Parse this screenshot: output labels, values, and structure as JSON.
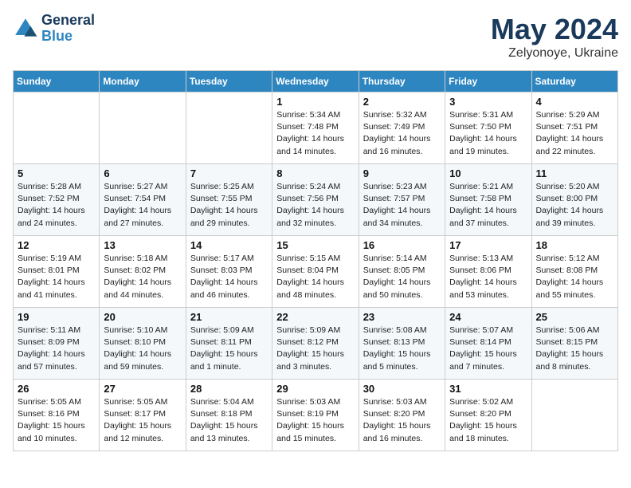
{
  "header": {
    "logo_line1": "General",
    "logo_line2": "Blue",
    "month": "May 2024",
    "location": "Zelyonoye, Ukraine"
  },
  "weekdays": [
    "Sunday",
    "Monday",
    "Tuesday",
    "Wednesday",
    "Thursday",
    "Friday",
    "Saturday"
  ],
  "weeks": [
    [
      {
        "day": "",
        "info": ""
      },
      {
        "day": "",
        "info": ""
      },
      {
        "day": "",
        "info": ""
      },
      {
        "day": "1",
        "info": "Sunrise: 5:34 AM\nSunset: 7:48 PM\nDaylight: 14 hours\nand 14 minutes."
      },
      {
        "day": "2",
        "info": "Sunrise: 5:32 AM\nSunset: 7:49 PM\nDaylight: 14 hours\nand 16 minutes."
      },
      {
        "day": "3",
        "info": "Sunrise: 5:31 AM\nSunset: 7:50 PM\nDaylight: 14 hours\nand 19 minutes."
      },
      {
        "day": "4",
        "info": "Sunrise: 5:29 AM\nSunset: 7:51 PM\nDaylight: 14 hours\nand 22 minutes."
      }
    ],
    [
      {
        "day": "5",
        "info": "Sunrise: 5:28 AM\nSunset: 7:52 PM\nDaylight: 14 hours\nand 24 minutes."
      },
      {
        "day": "6",
        "info": "Sunrise: 5:27 AM\nSunset: 7:54 PM\nDaylight: 14 hours\nand 27 minutes."
      },
      {
        "day": "7",
        "info": "Sunrise: 5:25 AM\nSunset: 7:55 PM\nDaylight: 14 hours\nand 29 minutes."
      },
      {
        "day": "8",
        "info": "Sunrise: 5:24 AM\nSunset: 7:56 PM\nDaylight: 14 hours\nand 32 minutes."
      },
      {
        "day": "9",
        "info": "Sunrise: 5:23 AM\nSunset: 7:57 PM\nDaylight: 14 hours\nand 34 minutes."
      },
      {
        "day": "10",
        "info": "Sunrise: 5:21 AM\nSunset: 7:58 PM\nDaylight: 14 hours\nand 37 minutes."
      },
      {
        "day": "11",
        "info": "Sunrise: 5:20 AM\nSunset: 8:00 PM\nDaylight: 14 hours\nand 39 minutes."
      }
    ],
    [
      {
        "day": "12",
        "info": "Sunrise: 5:19 AM\nSunset: 8:01 PM\nDaylight: 14 hours\nand 41 minutes."
      },
      {
        "day": "13",
        "info": "Sunrise: 5:18 AM\nSunset: 8:02 PM\nDaylight: 14 hours\nand 44 minutes."
      },
      {
        "day": "14",
        "info": "Sunrise: 5:17 AM\nSunset: 8:03 PM\nDaylight: 14 hours\nand 46 minutes."
      },
      {
        "day": "15",
        "info": "Sunrise: 5:15 AM\nSunset: 8:04 PM\nDaylight: 14 hours\nand 48 minutes."
      },
      {
        "day": "16",
        "info": "Sunrise: 5:14 AM\nSunset: 8:05 PM\nDaylight: 14 hours\nand 50 minutes."
      },
      {
        "day": "17",
        "info": "Sunrise: 5:13 AM\nSunset: 8:06 PM\nDaylight: 14 hours\nand 53 minutes."
      },
      {
        "day": "18",
        "info": "Sunrise: 5:12 AM\nSunset: 8:08 PM\nDaylight: 14 hours\nand 55 minutes."
      }
    ],
    [
      {
        "day": "19",
        "info": "Sunrise: 5:11 AM\nSunset: 8:09 PM\nDaylight: 14 hours\nand 57 minutes."
      },
      {
        "day": "20",
        "info": "Sunrise: 5:10 AM\nSunset: 8:10 PM\nDaylight: 14 hours\nand 59 minutes."
      },
      {
        "day": "21",
        "info": "Sunrise: 5:09 AM\nSunset: 8:11 PM\nDaylight: 15 hours\nand 1 minute."
      },
      {
        "day": "22",
        "info": "Sunrise: 5:09 AM\nSunset: 8:12 PM\nDaylight: 15 hours\nand 3 minutes."
      },
      {
        "day": "23",
        "info": "Sunrise: 5:08 AM\nSunset: 8:13 PM\nDaylight: 15 hours\nand 5 minutes."
      },
      {
        "day": "24",
        "info": "Sunrise: 5:07 AM\nSunset: 8:14 PM\nDaylight: 15 hours\nand 7 minutes."
      },
      {
        "day": "25",
        "info": "Sunrise: 5:06 AM\nSunset: 8:15 PM\nDaylight: 15 hours\nand 8 minutes."
      }
    ],
    [
      {
        "day": "26",
        "info": "Sunrise: 5:05 AM\nSunset: 8:16 PM\nDaylight: 15 hours\nand 10 minutes."
      },
      {
        "day": "27",
        "info": "Sunrise: 5:05 AM\nSunset: 8:17 PM\nDaylight: 15 hours\nand 12 minutes."
      },
      {
        "day": "28",
        "info": "Sunrise: 5:04 AM\nSunset: 8:18 PM\nDaylight: 15 hours\nand 13 minutes."
      },
      {
        "day": "29",
        "info": "Sunrise: 5:03 AM\nSunset: 8:19 PM\nDaylight: 15 hours\nand 15 minutes."
      },
      {
        "day": "30",
        "info": "Sunrise: 5:03 AM\nSunset: 8:20 PM\nDaylight: 15 hours\nand 16 minutes."
      },
      {
        "day": "31",
        "info": "Sunrise: 5:02 AM\nSunset: 8:20 PM\nDaylight: 15 hours\nand 18 minutes."
      },
      {
        "day": "",
        "info": ""
      }
    ]
  ]
}
